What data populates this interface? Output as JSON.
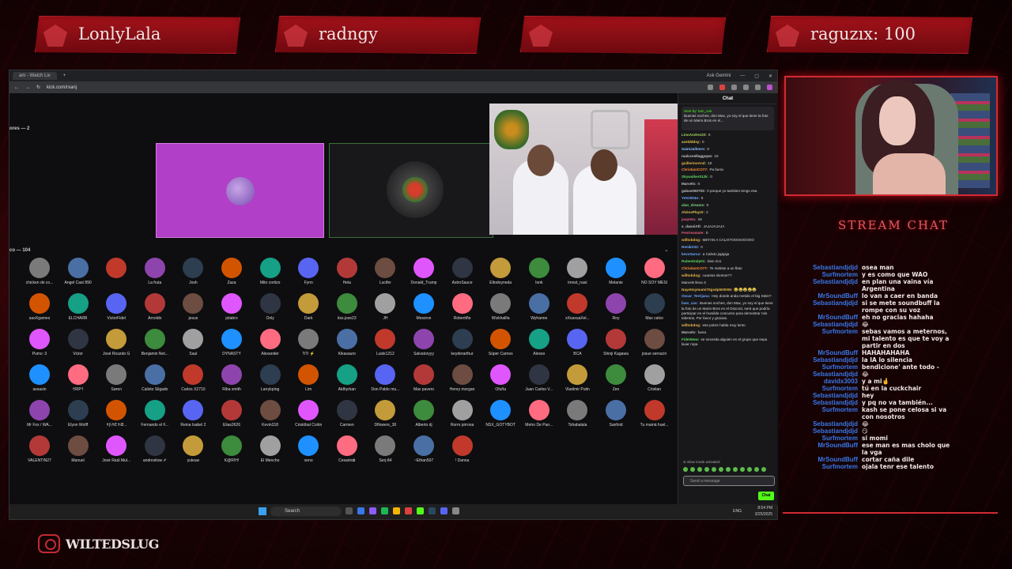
{
  "banners": [
    {
      "text": "LonlyLala"
    },
    {
      "text": "radngy"
    },
    {
      "text": ""
    },
    {
      "text": "raguzıx: 100"
    }
  ],
  "browser": {
    "tab_label": "am - Watch Liv",
    "url": "kick.com/rxanj",
    "profile": "Ask Gemini",
    "stage_label": "ores — 2",
    "audience_label": "co — 104"
  },
  "audience": [
    [
      "chicken de co...",
      "Angel Cast 890",
      "",
      "La fruta",
      "Josh",
      "Zaza",
      "Mito cortizo",
      "Fynn",
      "Hela",
      "Lucifer",
      "Donald_Trump",
      "AstroSauce",
      "Eltodoyneda",
      "Ionk",
      "imnot_nasi",
      "Melanie",
      "NO SOY MESI"
    ],
    [
      "saoXgames",
      "ELCHARR",
      "VictorFidel",
      "Arnoldo",
      "jesus",
      "jotabro",
      "Only",
      "Dark",
      "itss.jose23",
      "JH",
      "Messrve",
      "Robertiño",
      "Wizkhalifa",
      "Wyhanne",
      "xXxaxuaXel...",
      "Roy",
      "Max calvo"
    ],
    [
      "Pumo :3",
      "Victor",
      "José Ricardo G",
      "Benjamin Net...",
      "Saul",
      "DYNASTY",
      "Alexander",
      "TiTi ⚡",
      "Kikasauro",
      "Luisk1212",
      "Salvatoryyy",
      "keyderarthur",
      "Súper Carnes",
      "Alesso",
      "BCA",
      "Shinji Kagawa",
      "josue serracín"
    ],
    [
      "assasin",
      "†RIP†",
      "Søren",
      "Calixto Silgado",
      "Carlos X2710",
      "Riba smith",
      "Larrykping",
      "Lim",
      "Aldhyrkan",
      "Don Pablo mu...",
      "Max pavero",
      "Henry morgan",
      "Ofuña",
      "Juan Carlos V...",
      "Vladimir Putin",
      "Zen",
      "Cristian"
    ],
    [
      "Mr Fox / WA...",
      "Elyon Wolff",
      "✝ƑΛЄ✝Ø...",
      "Fernando el F...",
      "Reina Isabel 2",
      "Elias2626",
      "Kevin318",
      "Cristóbal Colón",
      "Carmen",
      "Dflowers_30",
      "Alberto dj",
      "Rorro pirrona",
      "NSX_GOTYBOT",
      "Metro De Pan...",
      "Tshabalala",
      "Sanfoid",
      "Tu mamá huel..."
    ],
    [
      "VALENTIN27",
      "Manuel",
      "José Raúl Mul...",
      "andresitow ✐",
      "yuleuw",
      "K@R!H!",
      "El Mencho",
      "xeno",
      "Cesarin✿",
      "Serj-84",
      "~Ethan507",
      "! Danna"
    ]
  ],
  "kick_chat": {
    "title": "Chat",
    "pinned_by": "Sent by: lam_cas",
    "pinned_text": "Buenas noches, don Max, yo soy el que tiene la foto de un Mario Bros en el...",
    "messages": [
      {
        "user": "LinoAndrez20:",
        "text": "0",
        "color": "#9fd35a"
      },
      {
        "user": "axeldddsy:",
        "text": "0",
        "color": "#e2c34b"
      },
      {
        "user": "SaintJaihmrs:",
        "text": "0",
        "color": "#8cc2ff"
      },
      {
        "user": "raulcorellaggvpw:",
        "text": "10",
        "color": "#c7c7c7"
      },
      {
        "user": "guillermoAnd:",
        "text": "10",
        "color": "#e8b64a"
      },
      {
        "user": "ChristianCO77:",
        "text": "Pa fuera",
        "color": "#ff8f3a"
      },
      {
        "user": "Skywalker012k:",
        "text": "0",
        "color": "#5fd65f"
      },
      {
        "user": "Marvels:",
        "text": "0",
        "color": "#c0c0c0"
      },
      {
        "user": "gabas050703:",
        "text": "0 porque yo tambien tengo esa",
        "color": "#c0c0c0"
      },
      {
        "user": "Yetsi004o:",
        "text": "0",
        "color": "#6ea8ff"
      },
      {
        "user": "alan_dreams:",
        "text": "0",
        "color": "#7ed67e"
      },
      {
        "user": "AlviosPlay3r:",
        "text": "2",
        "color": "#e2c34b"
      },
      {
        "user": "jaspieta:",
        "text": "44",
        "color": "#e65a7a"
      },
      {
        "user": "ʚ_danniAfr:",
        "text": "JAJAJAJAJA",
        "color": "#c0c0c0"
      },
      {
        "user": "Pestreamate:",
        "text": "0",
        "color": "#e65a7a"
      },
      {
        "user": "willtobdog:",
        "text": "METAN A CALIXTOOOOOOOO",
        "color": "#e8b64a"
      },
      {
        "user": "Renikir02:",
        "text": "0",
        "color": "#6ea8ff"
      },
      {
        "user": "kevoSarco:",
        "text": "a Calixto jajajaja",
        "color": "#6ea8ff"
      },
      {
        "user": "RubenDalp01:",
        "text": "bien rico",
        "color": "#5fd65f"
      },
      {
        "user": "ChristianCO77:",
        "text": "Te metiste a un flato",
        "color": "#ff8f3a"
      },
      {
        "user": "willtobdog:",
        "text": "cuantos sientos??",
        "color": "#e8b64a"
      },
      {
        "user": "Marvels",
        "text": "Marvels lleva 3",
        "color": "#c0c0c0",
        "full": true
      },
      {
        "user": "Nayetmymumi70gsdp500006:",
        "text": "😂😂😂😂😂",
        "color": "#e8b64a"
      },
      {
        "user": "Oscar_Terrijana:",
        "text": "Hey donde anda metido el big Stein?",
        "color": "#6ea8ff",
        "wrap": true
      },
      {
        "user": "liam_cas:",
        "text": "Buenas noches, don Max, yo soy el que tiene la foto de un Mario Bros en el Discord, será que podría participar en el humilde concurso para demostrar mis talentos, Por favor y gracias.",
        "color": "#6ea8ff",
        "wrap": true
      },
      {
        "user": "willtobdog:",
        "text": "ese pobre habla muy lento",
        "color": "#e8b64a"
      },
      {
        "user": "Marvels:",
        "text": "fuera",
        "color": "#c0c0c0"
      },
      {
        "user": "FideWww:",
        "text": "se necesita alguien en el grupo que sepa lavar ropa",
        "color": "#5fd65f",
        "wrap": true
      }
    ],
    "slow_mode": "⊘ Slow mode activated",
    "input_placeholder": "Send a message",
    "send_label": "Chat"
  },
  "taskbar": {
    "search": "Search",
    "time": "8:54 PM",
    "date": "3/25/2025",
    "lang": "ENG"
  },
  "stream_chat": {
    "title": "STREAM CHAT",
    "rows": [
      {
        "user": "Sebastiandjdjd",
        "text": "osea man"
      },
      {
        "user": "Surfmortem",
        "text": "y es como que WAO"
      },
      {
        "user": "Sebastiandjdjd",
        "text": "en plan una vaina vía"
      },
      {
        "user": "",
        "text": "Argentina"
      },
      {
        "user": "MrSoundBuff",
        "text": "lo van a caer en banda"
      },
      {
        "user": "Sebastiandjdjd",
        "text": "si se mete soundbuff la"
      },
      {
        "user": "",
        "text": "rompe con su voz"
      },
      {
        "user": "MrSoundBuff",
        "text": "eh no gracias hahaha"
      },
      {
        "user": "Sebastiandjdjd",
        "text": "😂"
      },
      {
        "user": "Surfmortem",
        "text": "sebas vamos a meternos,"
      },
      {
        "user": "",
        "text": "mi talento es que te voy a"
      },
      {
        "user": "",
        "text": "partir en dos"
      },
      {
        "user": "MrSoundBuff",
        "text": "HAHAHAHAHA"
      },
      {
        "user": "Sebastiandjdjd",
        "text": "la IA lo silencia"
      },
      {
        "user": "Surfmortem",
        "text": "bendicione' ante todo -"
      },
      {
        "user": "Sebastiandjdjd",
        "text": "😂"
      },
      {
        "user": "davidx3003",
        "text": "y a mi🤞"
      },
      {
        "user": "Surfmortem",
        "text": "tú en la cuckchair"
      },
      {
        "user": "Sebastiandjdjd",
        "text": "hey"
      },
      {
        "user": "Sebastiandjdjd",
        "text": "y pq no va también..."
      },
      {
        "user": "Surfmortem",
        "text": "kash se pone celosa si va"
      },
      {
        "user": "",
        "text": "con nosotros"
      },
      {
        "user": "Sebastiandjdjd",
        "text": "😂"
      },
      {
        "user": "Sebastiandjdjd",
        "text": "😏"
      },
      {
        "user": "Surfmortem",
        "text": "si momi"
      },
      {
        "user": "MrSoundBuff",
        "text": "ese man es mas cholo que"
      },
      {
        "user": "",
        "text": "la vga"
      },
      {
        "user": "MrSoundBuff",
        "text": "cortar caña dile"
      },
      {
        "user": "Surfmortem",
        "text": "ojala tenr ese talento"
      }
    ]
  },
  "brand": {
    "name": "WILTEDSLUG",
    "accent": "#d22a33"
  },
  "colors": {
    "kick_green": "#53fc18",
    "stage_purple": "#b13fc7",
    "stream_user_blue": "#3a78e8"
  }
}
